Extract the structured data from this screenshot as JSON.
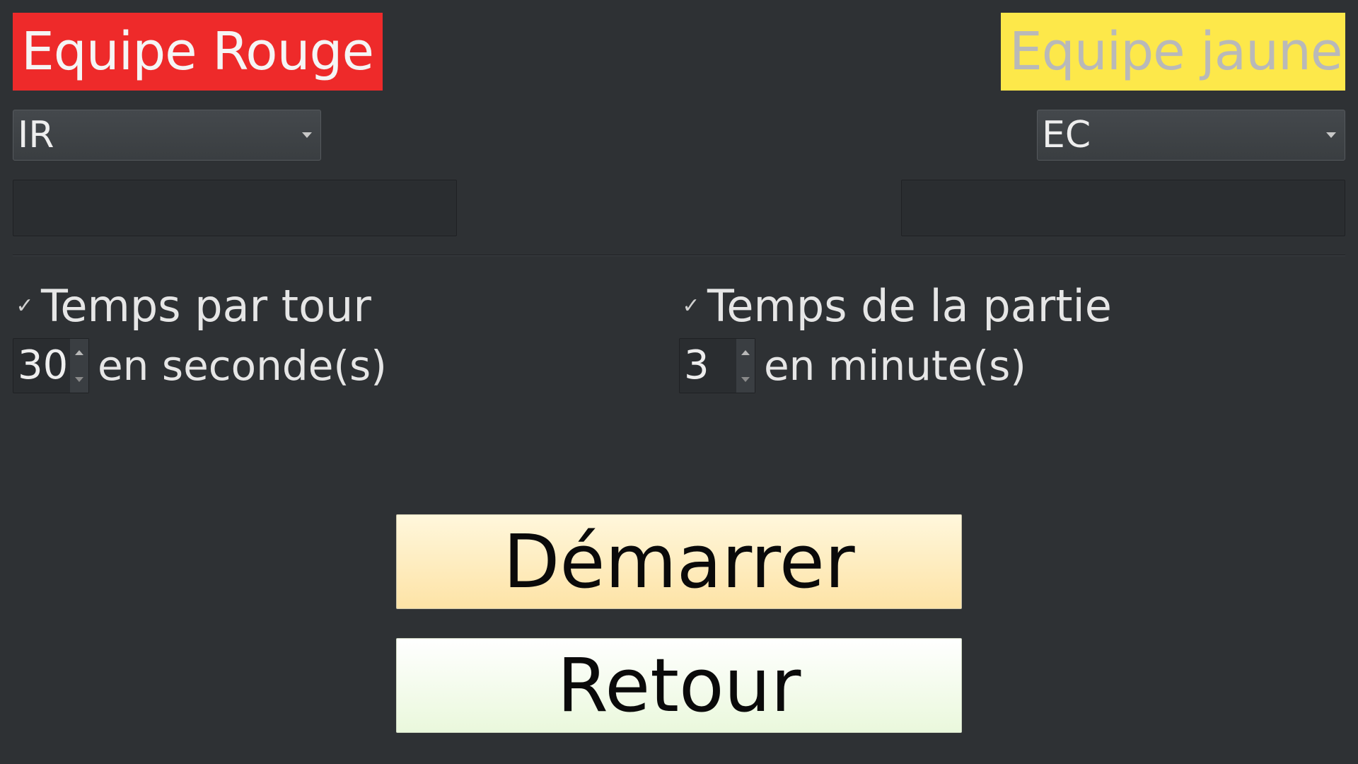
{
  "teams": {
    "red": {
      "label": "Equipe Rouge",
      "bg_color": "#ee2a2a",
      "text_color": "#f5f5f5",
      "selected": "IR",
      "name_value": ""
    },
    "yellow": {
      "label": "Equipe jaune",
      "bg_color": "#fde84a",
      "text_color": "#b9b9b9",
      "selected": "EC",
      "name_value": ""
    }
  },
  "timers": {
    "turn": {
      "checked": true,
      "check_glyph": "✓",
      "label": "Temps par tour",
      "value": "30",
      "unit": "en seconde(s)"
    },
    "game": {
      "checked": true,
      "check_glyph": "✓",
      "label": "Temps de la partie",
      "value": "3",
      "unit": "en minute(s)"
    }
  },
  "buttons": {
    "start_label": "Démarrer",
    "back_label": "Retour"
  }
}
